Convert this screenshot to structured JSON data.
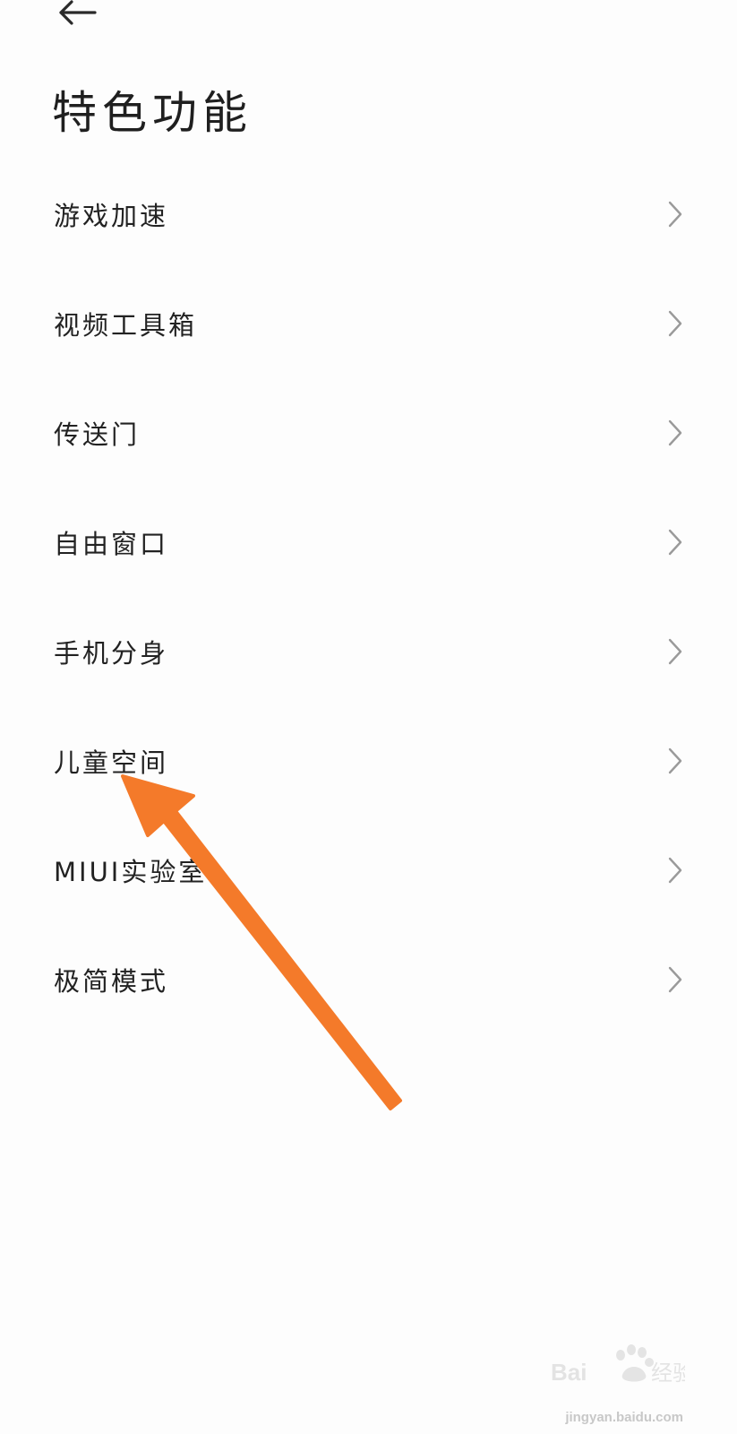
{
  "header": {
    "back_icon": "arrow-left-icon",
    "title": "特色功能"
  },
  "menu": {
    "items": [
      {
        "label": "游戏加速",
        "icon": "chevron-right-icon"
      },
      {
        "label": "视频工具箱",
        "icon": "chevron-right-icon"
      },
      {
        "label": "传送门",
        "icon": "chevron-right-icon"
      },
      {
        "label": "自由窗口",
        "icon": "chevron-right-icon"
      },
      {
        "label": "手机分身",
        "icon": "chevron-right-icon"
      },
      {
        "label": "儿童空间",
        "icon": "chevron-right-icon"
      },
      {
        "label": "MIUI实验室",
        "icon": "chevron-right-icon"
      },
      {
        "label": "极简模式",
        "icon": "chevron-right-icon"
      }
    ]
  },
  "annotation": {
    "arrow_color": "#f47a2a"
  },
  "watermark": {
    "logo": "Baidu经验",
    "url": "jingyan.baidu.com"
  },
  "colors": {
    "background": "#fdfdfd",
    "text": "#222222",
    "chevron": "#9a9a9a"
  }
}
